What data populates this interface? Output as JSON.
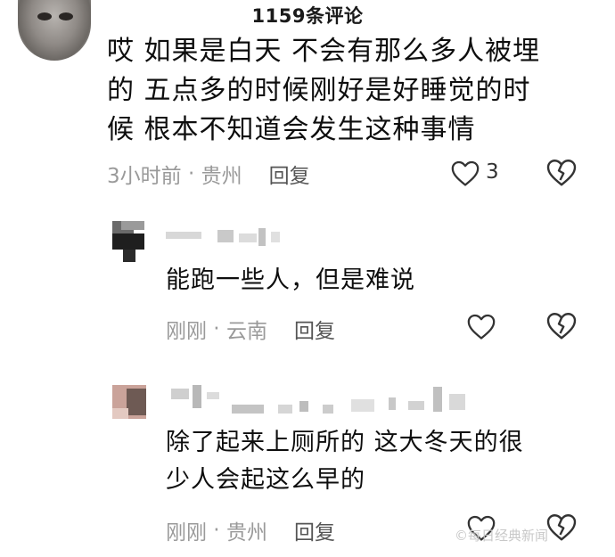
{
  "header": {
    "title": "1159条评论"
  },
  "main_comment": {
    "lines": [
      "哎  如果是白天 不会有那么多人被埋",
      "的  五点多的时候刚好是好睡觉的时",
      "候  根本不知道会发生这种事情"
    ],
    "time": "3小时前",
    "location": "贵州",
    "reply_label": "回复",
    "like_count": "3"
  },
  "replies": [
    {
      "text_lines": [
        "能跑一些人，但是难说"
      ],
      "time": "刚刚",
      "location": "云南",
      "reply_label": "回复"
    },
    {
      "text_lines": [
        "除了起来上厕所的  这大冬天的很",
        "少人会起这么早的"
      ],
      "time": "刚刚",
      "location": "贵州",
      "reply_label": "回复"
    }
  ],
  "watermark": "©每日经典新闻"
}
